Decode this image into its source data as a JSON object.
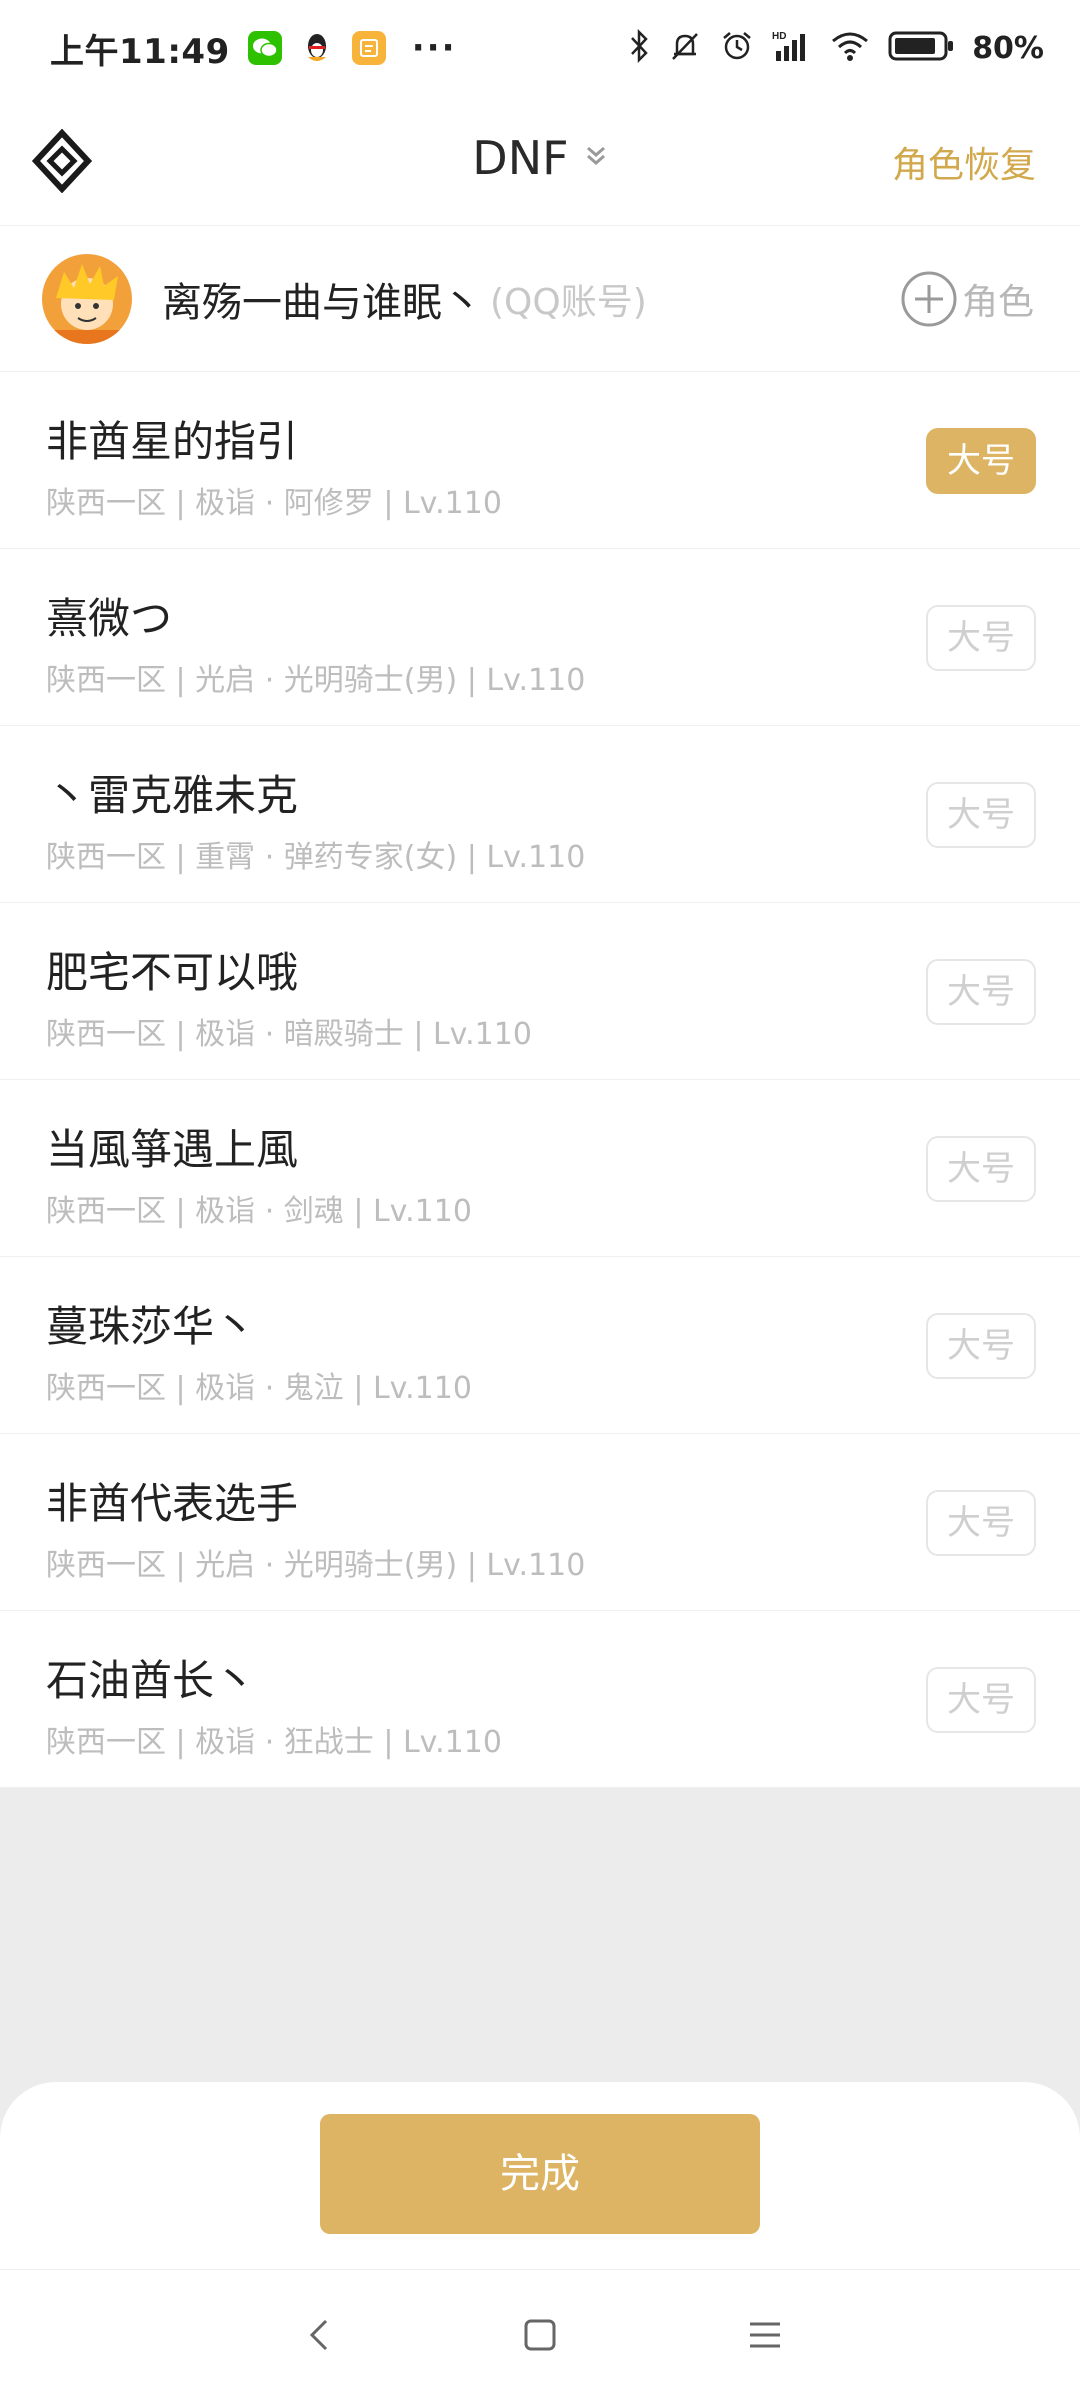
{
  "status_bar": {
    "time": "上午11:49",
    "battery": "80%",
    "icons": [
      "wechat-icon",
      "qq-icon",
      "notes-icon",
      "more-icon",
      "bluetooth-icon",
      "mute-icon",
      "alarm-icon",
      "signal-icon",
      "wifi-icon",
      "battery-icon"
    ]
  },
  "header": {
    "logo": "dnf-logo-icon",
    "title": "DNF",
    "restore_label": "角色恢复"
  },
  "account": {
    "name": "离殇一曲与谁眠丶",
    "type": "(QQ账号)",
    "add_role_label": "角色"
  },
  "roles": [
    {
      "name": "非酋星的指引",
      "info": "陕西一区 | 极诣 · 阿修罗 | Lv.110",
      "badge": "大号",
      "is_main": true
    },
    {
      "name": "熹微つ",
      "info": "陕西一区 | 光启 · 光明骑士(男) | Lv.110",
      "badge": "大号",
      "is_main": false
    },
    {
      "name": "丶雷克雅未克",
      "info": "陕西一区 | 重霄 · 弹药专家(女) | Lv.110",
      "badge": "大号",
      "is_main": false
    },
    {
      "name": "肥宅不可以哦",
      "info": "陕西一区 | 极诣 · 暗殿骑士 | Lv.110",
      "badge": "大号",
      "is_main": false
    },
    {
      "name": "当風箏遇上風",
      "info": "陕西一区 | 极诣 · 剑魂 | Lv.110",
      "badge": "大号",
      "is_main": false
    },
    {
      "name": "蔓珠莎华丶",
      "info": "陕西一区 | 极诣 · 鬼泣 | Lv.110",
      "badge": "大号",
      "is_main": false
    },
    {
      "name": "非酋代表选手",
      "info": "陕西一区 | 光启 · 光明骑士(男) | Lv.110",
      "badge": "大号",
      "is_main": false
    },
    {
      "name": "石油酋长丶",
      "info": "陕西一区 | 极诣 · 狂战士 | Lv.110",
      "badge": "大号",
      "is_main": false
    }
  ],
  "footer": {
    "done_label": "完成"
  },
  "nav": {
    "icons": [
      "back-icon",
      "home-icon",
      "menu-icon"
    ]
  },
  "colors": {
    "accent": "#dcb463",
    "restore_text": "#d2a84c",
    "secondary_text": "#bdbdbd"
  }
}
